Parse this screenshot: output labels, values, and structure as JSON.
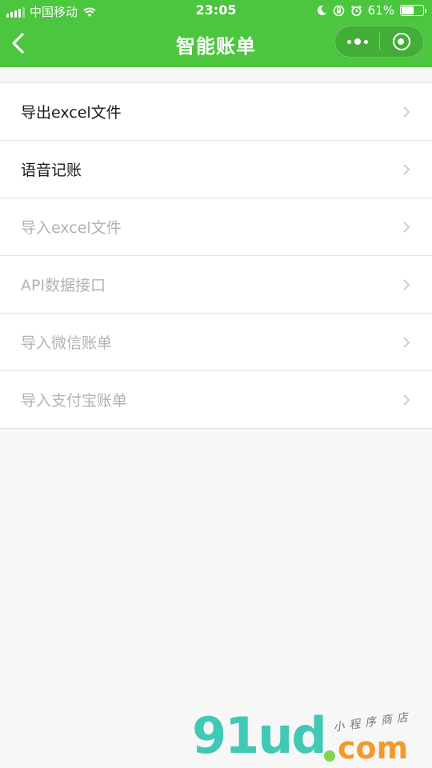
{
  "status_bar": {
    "carrier": "中国移动",
    "time": "23:05",
    "battery_percent_label": "61%",
    "battery_level": 0.61
  },
  "nav": {
    "title": "智能账单"
  },
  "colors": {
    "header_green": "#4cc53f",
    "page_background": "#f7f7f7",
    "text_enabled": "#1a1a1a",
    "text_disabled": "#b2b2b2"
  },
  "menu": {
    "items": [
      {
        "label": "导出excel文件",
        "enabled": true
      },
      {
        "label": "语音记账",
        "enabled": true
      },
      {
        "label": "导入excel文件",
        "enabled": false
      },
      {
        "label": "API数据接口",
        "enabled": false
      },
      {
        "label": "导入微信账单",
        "enabled": false
      },
      {
        "label": "导入支付宝账单",
        "enabled": false
      }
    ]
  },
  "watermark": {
    "brand": "91ud",
    "domain": "com",
    "tagline": "小程序商店"
  }
}
